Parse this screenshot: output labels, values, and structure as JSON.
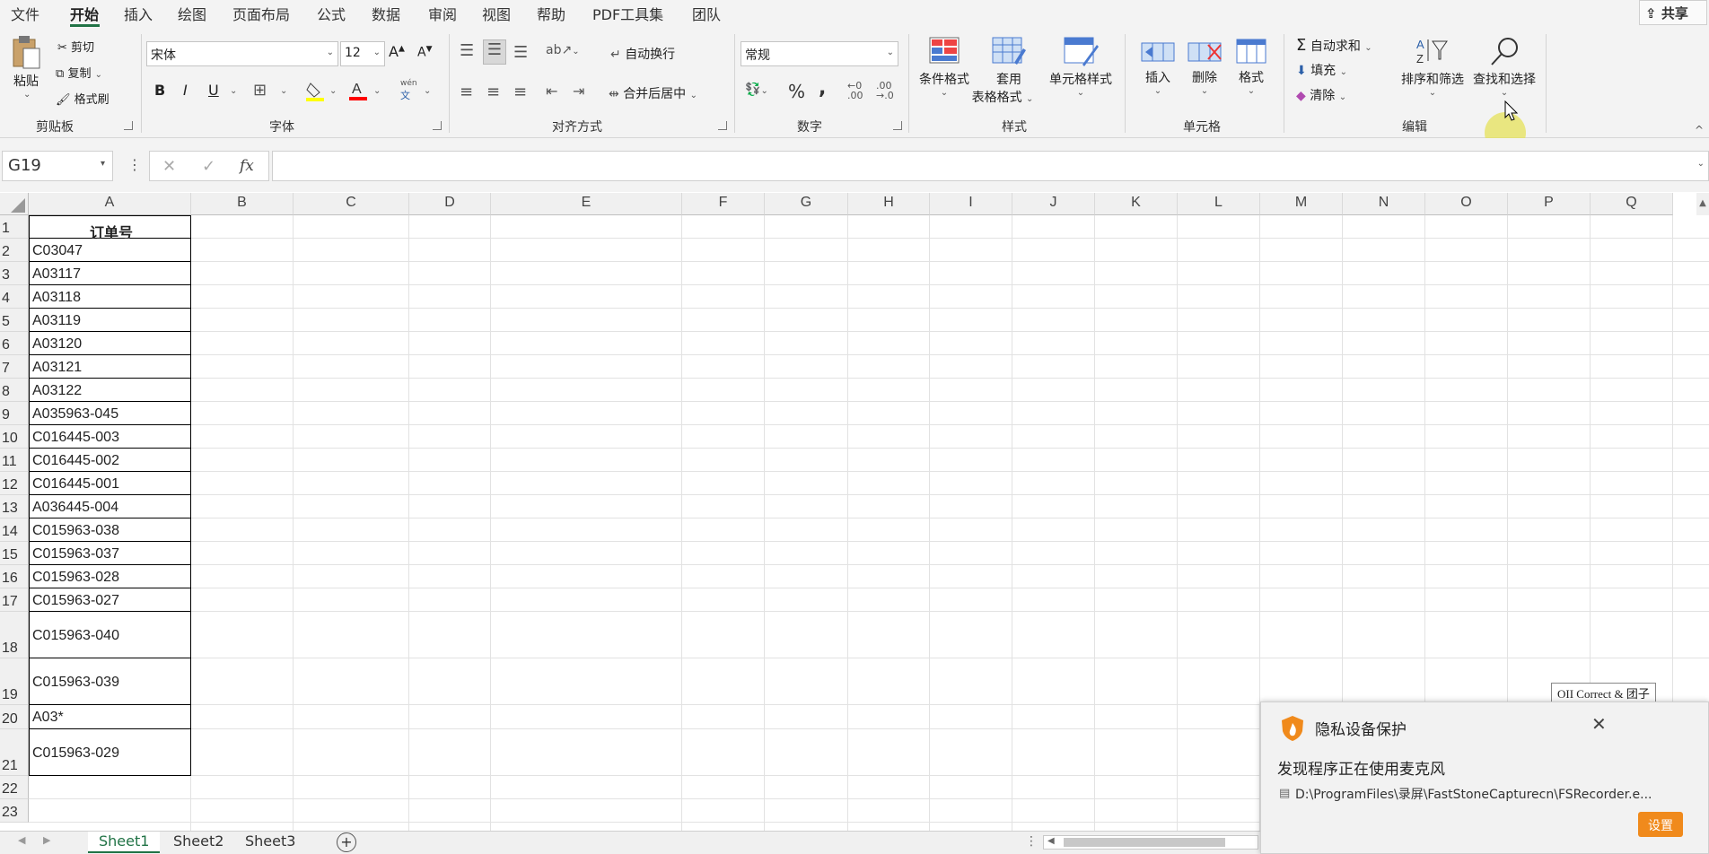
{
  "menubar": {
    "tabs": [
      "文件",
      "开始",
      "插入",
      "绘图",
      "页面布局",
      "公式",
      "数据",
      "审阅",
      "视图",
      "帮助",
      "PDF工具集",
      "团队"
    ],
    "active_tab": "开始",
    "share": "共享"
  },
  "clipboard": {
    "paste": "粘贴",
    "cut": "剪切",
    "copy": "复制",
    "format_painter": "格式刷",
    "group": "剪贴板"
  },
  "font": {
    "name": "宋体",
    "size": "12",
    "bold": "B",
    "italic": "I",
    "underline": "U",
    "phonetic": "wén",
    "group": "字体",
    "font_color": "#ff0000",
    "fill_color": "#ffff00"
  },
  "alignment": {
    "wrap": "自动换行",
    "merge": "合并后居中",
    "group": "对齐方式"
  },
  "number": {
    "format": "常规",
    "percent": "%",
    "comma": ",",
    "group": "数字"
  },
  "styles": {
    "conditional": "条件格式",
    "table_line1": "套用",
    "table_line2": "表格格式",
    "cell_styles": "单元格样式",
    "group": "样式"
  },
  "cells": {
    "insert": "插入",
    "delete": "删除",
    "format": "格式",
    "group": "单元格"
  },
  "editing": {
    "autosum": "自动求和",
    "fill": "填充",
    "clear": "清除",
    "sort": "排序和筛选",
    "find": "查找和选择",
    "group": "编辑"
  },
  "formula_bar": {
    "name_box": "G19",
    "cancel": "✕",
    "enter": "✓",
    "fx": "fx",
    "value": ""
  },
  "columns": [
    "A",
    "B",
    "C",
    "D",
    "E",
    "F",
    "G",
    "H",
    "I",
    "J",
    "K",
    "L",
    "M",
    "N",
    "O",
    "P",
    "Q"
  ],
  "rows": [
    "1",
    "2",
    "3",
    "4",
    "5",
    "6",
    "7",
    "8",
    "9",
    "10",
    "11",
    "12",
    "13",
    "14",
    "15",
    "16",
    "17",
    "18",
    "19",
    "20",
    "21",
    "22",
    "23"
  ],
  "cells_A": [
    "订单号",
    "C03047",
    "A03117",
    "A03118",
    "A03119",
    "A03120",
    "A03121",
    "A03122",
    "A035963-045",
    "C016445-003",
    "C016445-002",
    "C016445-001",
    "A036445-004",
    "C015963-038",
    "C015963-037",
    "C015963-028",
    "C015963-027",
    "C015963-040",
    "C015963-039",
    "A03*",
    "C015963-029"
  ],
  "sheets": [
    "Sheet1",
    "Sheet2",
    "Sheet3"
  ],
  "active_sheet": "Sheet1",
  "tooltip": "OII Correct & 团子",
  "popup": {
    "title": "隐私设备保护",
    "message": "发现程序正在使用麦克风",
    "path": "D:\\ProgramFiles\\录屏\\FastStoneCapturecn\\FSRecorder.e...",
    "button": "设置",
    "close": "✕"
  }
}
